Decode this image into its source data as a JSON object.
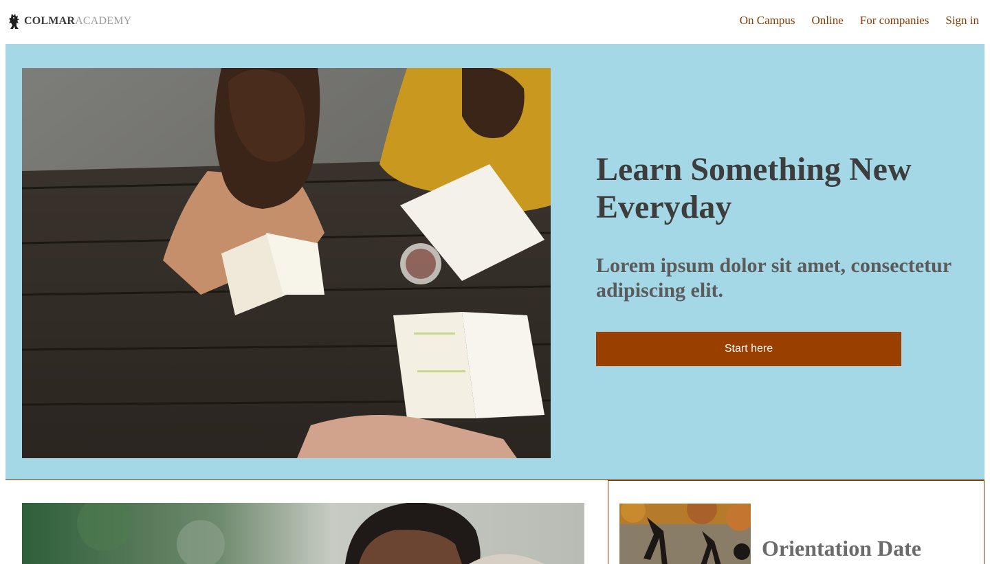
{
  "brand": {
    "name_bold": "COLMAR",
    "name_light": "ACADEMY",
    "logo_icon": "griffin-icon"
  },
  "nav": {
    "items": [
      "On Campus",
      "Online",
      "For companies",
      "Sign in"
    ]
  },
  "hero": {
    "title": "Learn Something New Everyday",
    "subtitle": "Lorem ipsum dolor sit amet, consectetur adipiscing elit.",
    "cta_label": "Start here",
    "image": "students-studying-photo"
  },
  "feature": {
    "image": "student-portrait-photo"
  },
  "card": {
    "title": "Orientation Date",
    "image": "autumn-shadows-photo"
  },
  "colors": {
    "accent": "#993f00",
    "hero_bg": "#a4d8e6",
    "link": "#8a3a00"
  }
}
